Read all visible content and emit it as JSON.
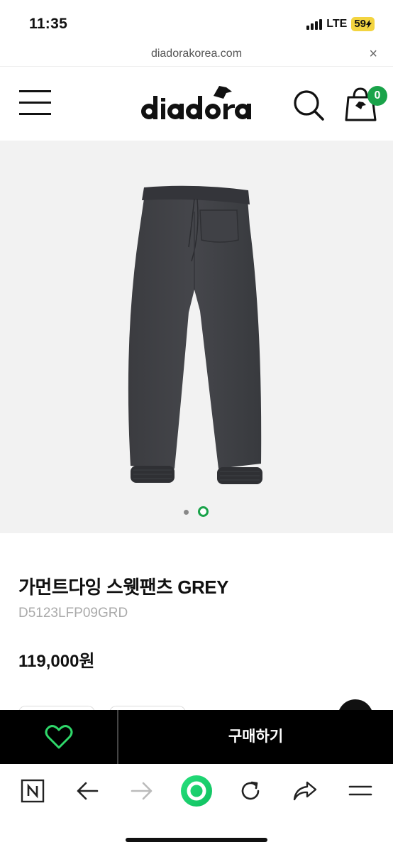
{
  "status_bar": {
    "time": "11:35",
    "network": "LTE",
    "battery": "59"
  },
  "browser": {
    "url": "diadorakorea.com",
    "close_label": "×"
  },
  "header": {
    "logo_text": "diadora",
    "cart_count": "0",
    "menu_icon": "hamburger-menu-icon",
    "search_icon": "search-icon",
    "cart_icon": "shopping-bag-icon"
  },
  "gallery": {
    "total_images": 2,
    "active_index": 2
  },
  "product": {
    "title": "가먼트다잉 스웻팬츠 GREY",
    "code": "D5123LFP09GRD",
    "price": "119,000원"
  },
  "actions": {
    "wish_icon": "heart-icon",
    "buy_label": "구매하기"
  },
  "browser_nav": {
    "items": [
      "naver-icon",
      "back-arrow-icon",
      "forward-arrow-icon",
      "green-home-icon",
      "reload-icon",
      "share-icon",
      "menu-icon"
    ]
  },
  "colors": {
    "accent_green": "#1aa34a",
    "battery_yellow": "#f3d440",
    "bar_black": "#000000",
    "image_bg": "#f2f2f2"
  }
}
